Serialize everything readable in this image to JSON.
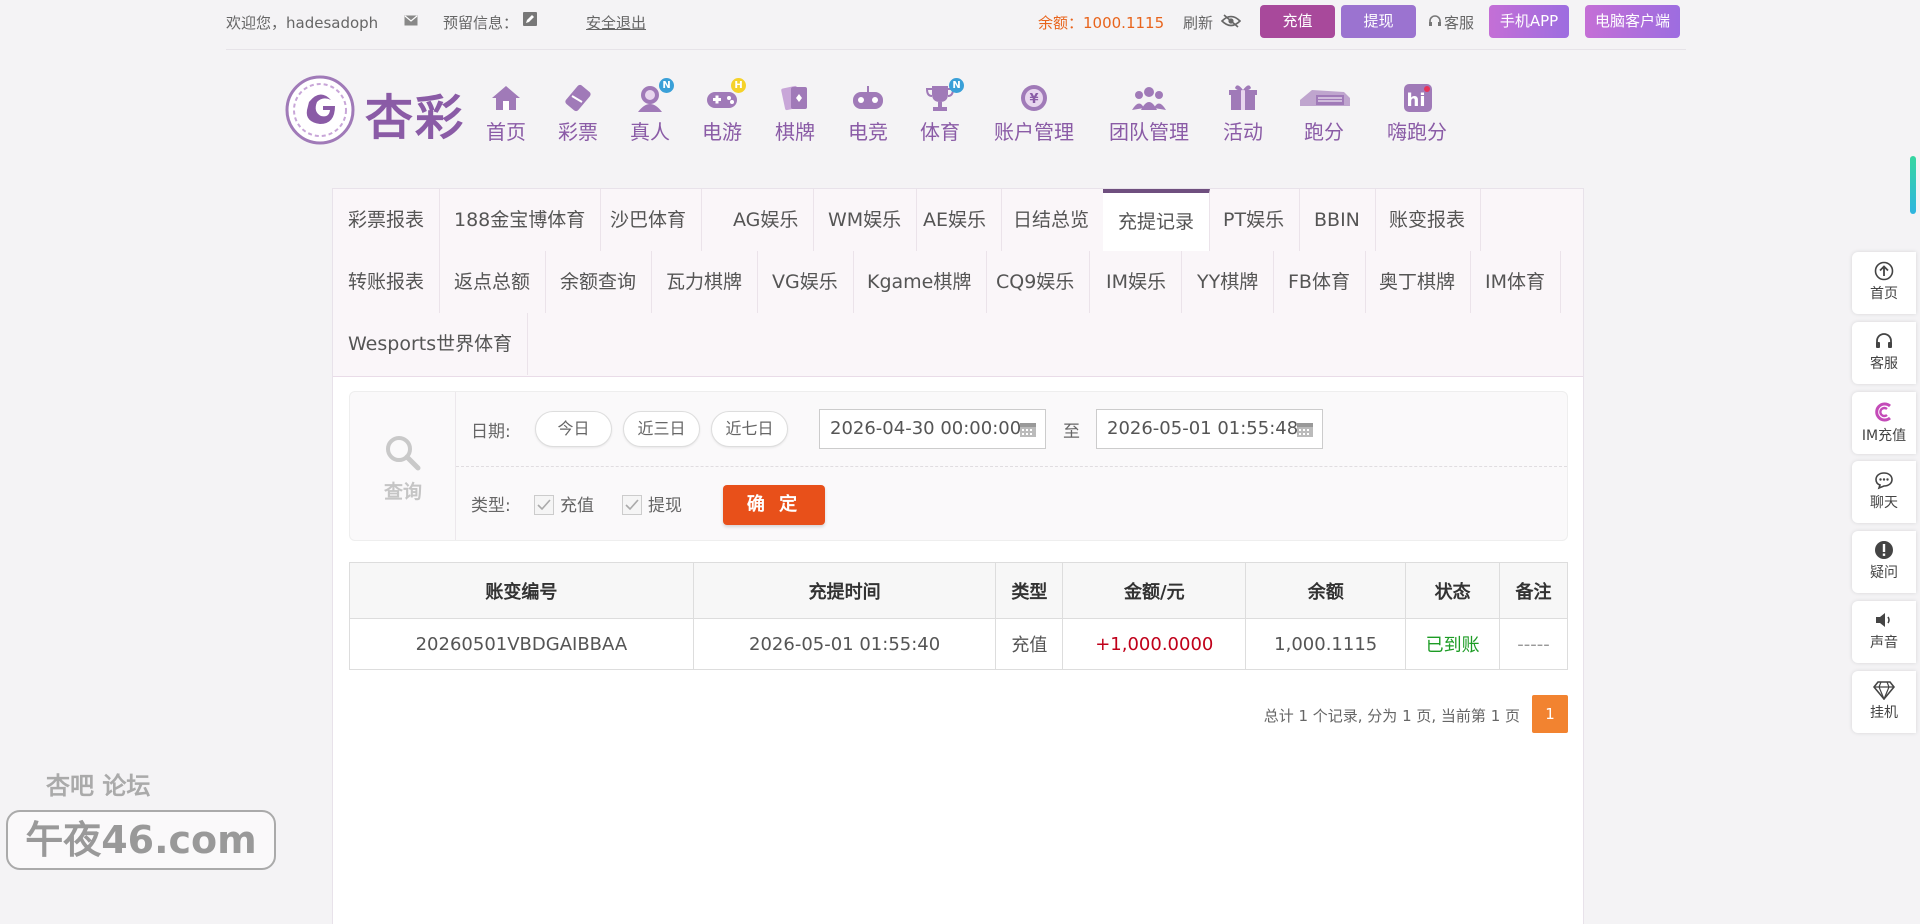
{
  "topbar": {
    "welcome": "欢迎您，hadesadoph",
    "reserved_info": "预留信息：",
    "logout": "安全退出",
    "balance": "余额：1000.1115",
    "refresh": "刷新",
    "deposit_button": "充值",
    "withdraw_button": "提现",
    "service": "客服",
    "mobile_app": "手机APP",
    "pc_client": "电脑客户端"
  },
  "logo": {
    "text": "杏彩"
  },
  "nav": [
    {
      "label": "首页",
      "icon": "home-icon"
    },
    {
      "label": "彩票",
      "icon": "lottery-icon"
    },
    {
      "label": "真人",
      "icon": "live-icon",
      "badge": "N"
    },
    {
      "label": "电游",
      "icon": "gamepad-icon",
      "badge": "H"
    },
    {
      "label": "棋牌",
      "icon": "cards-icon"
    },
    {
      "label": "电竞",
      "icon": "controller-icon"
    },
    {
      "label": "体育",
      "icon": "trophy-icon",
      "badge": "N"
    },
    {
      "label": "账户管理",
      "icon": "account-icon"
    },
    {
      "label": "团队管理",
      "icon": "team-icon"
    },
    {
      "label": "活动",
      "icon": "gift-icon"
    },
    {
      "label": "跑分",
      "icon": "car-icon"
    },
    {
      "label": "嗨跑分",
      "icon": "hi-icon"
    }
  ],
  "tabs": [
    "彩票报表",
    "188金宝博体育",
    "沙巴体育",
    "AG娱乐",
    "WM娱乐",
    "AE娱乐",
    "日结总览",
    "充提记录",
    "PT娱乐",
    "BBIN",
    "账变报表",
    "转账报表",
    "返点总额",
    "余额查询",
    "瓦力棋牌",
    "VG娱乐",
    "Kgame棋牌",
    "CQ9娱乐",
    "IM娱乐",
    "YY棋牌",
    "FB体育",
    "奥丁棋牌",
    "IM体育",
    "Wesports世界体育"
  ],
  "active_tab": "充提记录",
  "search": {
    "side_label": "查询",
    "date_label": "日期:",
    "today": "今日",
    "three_days": "近三日",
    "seven_days": "近七日",
    "start_date": "2026-04-30 00:00:00",
    "to": "至",
    "end_date": "2026-05-01 01:55:48",
    "type_label": "类型:",
    "type_deposit": "充值",
    "type_withdraw": "提现",
    "confirm": "确 定"
  },
  "table": {
    "headers": [
      "账变编号",
      "充提时间",
      "类型",
      "金额/元",
      "余额",
      "状态",
      "备注"
    ],
    "rows": [
      [
        "20260501VBDGAIBBAA",
        "2026-05-01 01:55:40",
        "充值",
        "+1,000.0000",
        "1,000.1115",
        "已到账",
        "-----"
      ]
    ]
  },
  "pager": {
    "info": "总计 1 个记录, 分为 1 页, 当前第 1 页",
    "current": "1"
  },
  "float_menu": [
    {
      "label": "首页",
      "icon": "arrow-up-circle-icon"
    },
    {
      "label": "客服",
      "icon": "headset-icon"
    },
    {
      "label": "IM充值",
      "icon": "im-recharge-icon"
    },
    {
      "label": "聊天",
      "icon": "chat-icon"
    },
    {
      "label": "疑问",
      "icon": "question-icon"
    },
    {
      "label": "声音",
      "icon": "speaker-icon"
    },
    {
      "label": "挂机",
      "icon": "diamond-icon"
    }
  ],
  "watermark": {
    "top": "杏吧  论坛",
    "main": "午夜46.com"
  },
  "colors": {
    "brand_purple": "#8a5ba6",
    "deposit_btn": "#a8499b",
    "withdraw_btn": "#9b73d0",
    "balance_text": "#e8641c",
    "confirm_btn": "#e8501a",
    "amount_text": "#c0001a",
    "status_text": "#1d9c25",
    "pager_active": "#f28330"
  }
}
